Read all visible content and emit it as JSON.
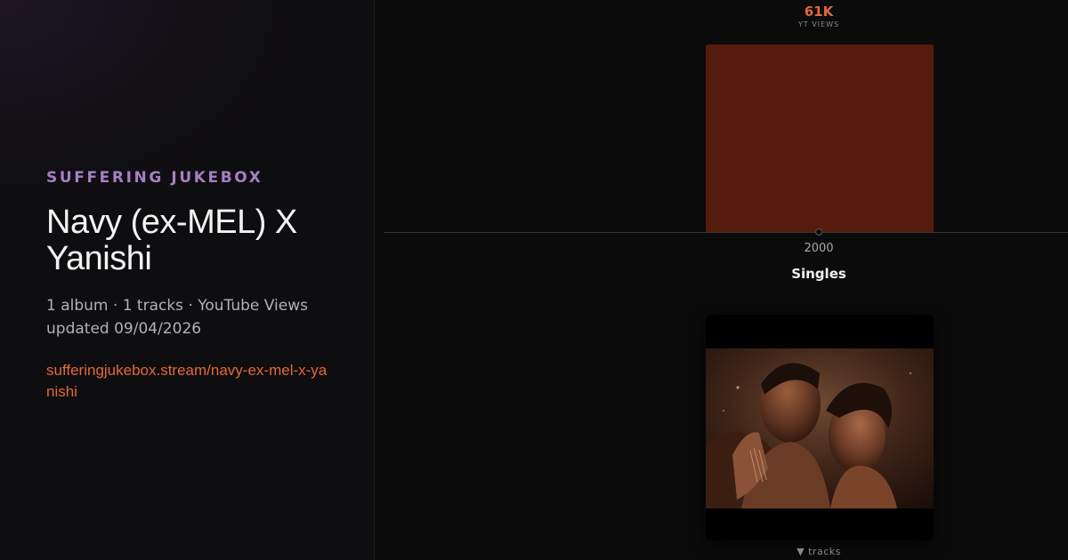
{
  "brand": "SUFFERING JUKEBOX",
  "artist": {
    "name": "Navy (ex-MEL) X Yanishi"
  },
  "meta": {
    "summary": "1 album · 1 tracks · YouTube Views",
    "updated": "updated 09/04/2026"
  },
  "link": "sufferingjukebox.stream/navy-ex-mel-x-yanishi",
  "stats": {
    "value": "61K",
    "label": "YT VIEWS"
  },
  "chart_data": {
    "type": "bar",
    "categories": [
      "2000"
    ],
    "values": [
      61000
    ],
    "value_labels": [
      "61K"
    ],
    "ylim": [
      0,
      61000
    ],
    "colors": {
      "bar": "#561b0c",
      "accent": "#e4683a"
    }
  },
  "section": {
    "title": "Singles"
  },
  "album": {
    "art": "album-cover-image"
  },
  "tracks_toggle": {
    "icon": "triangle-down-icon",
    "label": "▼ tracks"
  },
  "colors": {
    "brand": "#a67fc4",
    "accent": "#e4683a",
    "background": "#0b0b0c"
  }
}
